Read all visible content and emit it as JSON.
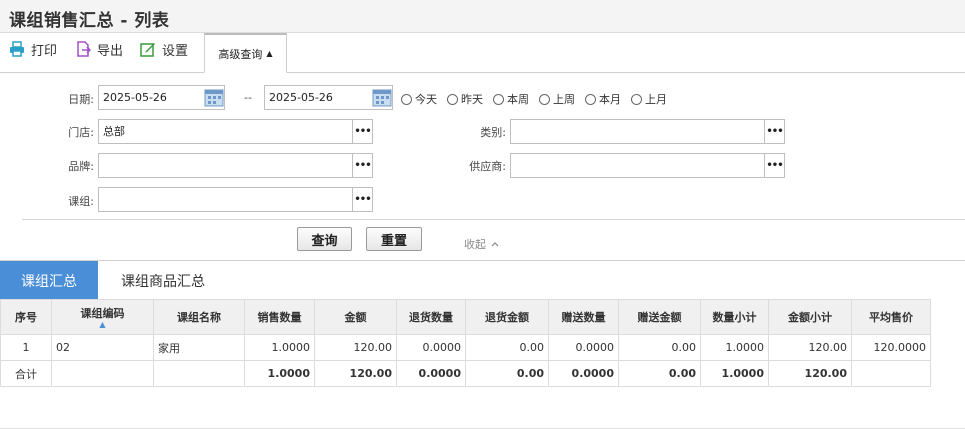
{
  "page": {
    "title": "课组销售汇总 - 列表"
  },
  "toolbar": {
    "print_label": "打印",
    "export_label": "导出",
    "settings_label": "设置",
    "advanced_label": "高级查询"
  },
  "filter": {
    "date_label": "日期:",
    "date_from": "2025-05-26",
    "date_sep": "--",
    "date_to": "2025-05-26",
    "quick_dates": [
      "今天",
      "昨天",
      "本周",
      "上周",
      "本月",
      "上月"
    ],
    "store_label": "门店:",
    "store_value": "总部",
    "category_label": "类别:",
    "category_value": "",
    "brand_label": "品牌:",
    "brand_value": "",
    "supplier_label": "供应商:",
    "supplier_value": "",
    "group_label": "课组:",
    "group_value": "",
    "query_button": "查询",
    "reset_button": "重置",
    "collapse_label": "收起"
  },
  "tabs": {
    "summary": "课组汇总",
    "goods": "课组商品汇总"
  },
  "table": {
    "headers": [
      "序号",
      "课组编码",
      "课组名称",
      "销售数量",
      "金额",
      "退货数量",
      "退货金额",
      "赠送数量",
      "赠送金额",
      "数量小计",
      "金额小计",
      "平均售价"
    ],
    "rows": [
      [
        "1",
        "02",
        "家用",
        "1.0000",
        "120.00",
        "0.0000",
        "0.00",
        "0.0000",
        "0.00",
        "1.0000",
        "120.00",
        "120.0000"
      ]
    ],
    "total_row": [
      "合计",
      "",
      "",
      "1.0000",
      "120.00",
      "0.0000",
      "0.00",
      "0.0000",
      "0.00",
      "1.0000",
      "120.00",
      ""
    ]
  },
  "colors": {
    "accent": "#4a8ed8",
    "print_icon": "#2aa0c8",
    "export_icon": "#a050c8",
    "settings_icon": "#3a9a3a"
  }
}
